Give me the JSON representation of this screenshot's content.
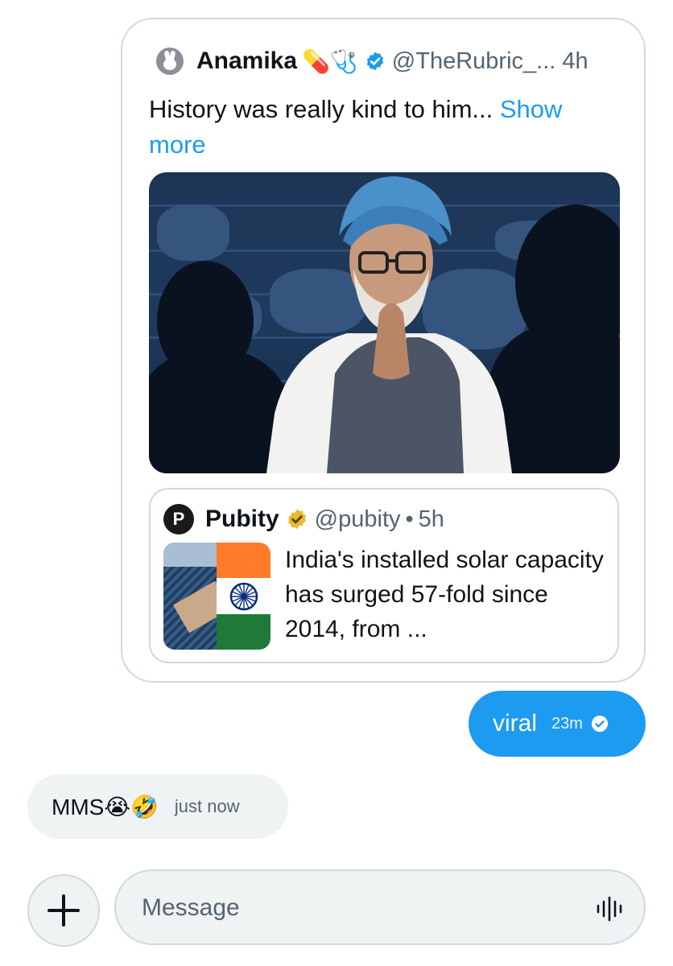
{
  "quoted_tweet": {
    "author_name": "Anamika",
    "author_emojis": "💊🩺",
    "handle": "@TheRubric_...",
    "time": "4h",
    "text": "History was really kind to him... ",
    "show_more": "Show more",
    "icons": [
      "rabbit-avatar-icon",
      "verified-blue-icon"
    ],
    "nested_quote": {
      "author_name": "Pubity",
      "logo_letter": "P",
      "handle": "@pubity",
      "separator": "•",
      "time": "5h",
      "text": "India's installed solar capacity has surged 57-fold since 2014, from ...",
      "icons": [
        "pubity-logo-icon",
        "verified-gold-icon",
        "india-flag-icon",
        "solar-panel-photo-icon"
      ]
    }
  },
  "messages": [
    {
      "direction": "outgoing",
      "text": "viral",
      "time": "23m",
      "status_icon": "read-check-icon"
    },
    {
      "direction": "incoming",
      "text": "MMS😭🤣",
      "time": "just now"
    }
  ],
  "composer": {
    "placeholder": "Message",
    "value": "",
    "add_icon": "plus-icon",
    "voice_icon": "voice-waveform-icon"
  },
  "colors": {
    "accent": "#1d9bf0",
    "bubble_incoming": "#eff3f4",
    "border": "#cfd9de",
    "secondary_text": "#536471",
    "gold_badge": "#e8b931"
  }
}
